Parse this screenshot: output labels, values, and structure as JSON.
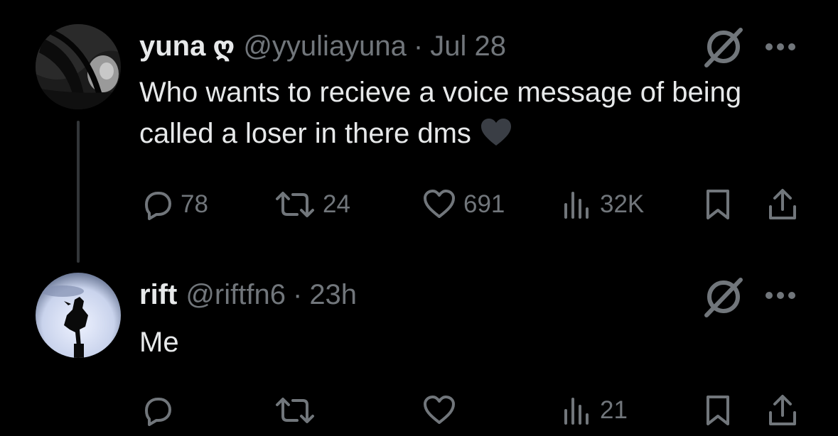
{
  "tweets": [
    {
      "author": {
        "display_name": "yuna",
        "emoji": "ღ",
        "handle": "@yyuliayuna",
        "avatar_icon": "avatar-dark-hair-photo"
      },
      "separator": "·",
      "time": "Jul 28",
      "text": "Who wants to recieve a voice message of being called a loser in there dms",
      "inline_emoji": "black-heart-icon",
      "stats": {
        "replies": "78",
        "reposts": "24",
        "likes": "691",
        "views": "32K"
      }
    },
    {
      "author": {
        "display_name": "rift",
        "handle": "@riftfn6",
        "avatar_icon": "avatar-anime-silhouette-moon"
      },
      "separator": "·",
      "time": "23h",
      "text": "Me",
      "stats": {
        "replies": "",
        "reposts": "",
        "likes": "",
        "views": "21"
      }
    }
  ],
  "colors": {
    "background": "#000000",
    "primary_text": "#e7e9ea",
    "secondary_text": "#71767b",
    "thread_line": "#333639"
  }
}
